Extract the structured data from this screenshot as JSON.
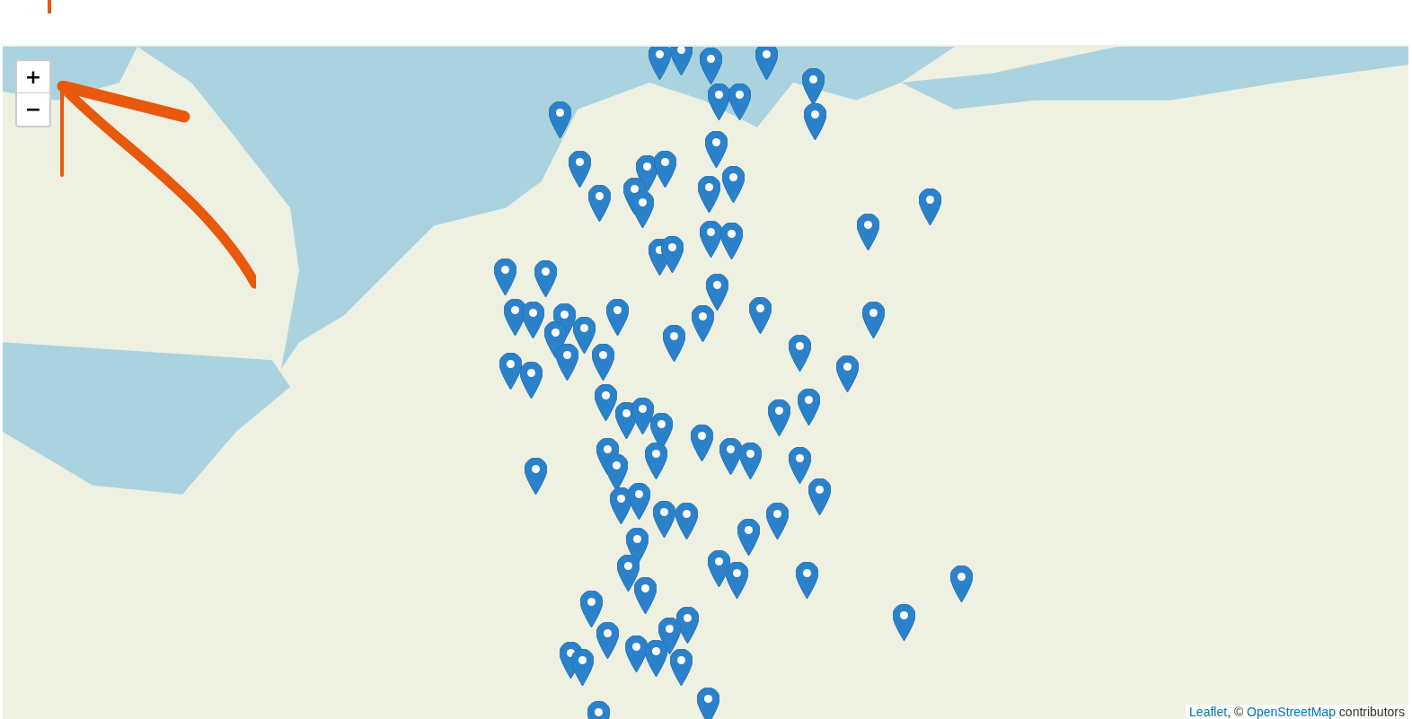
{
  "map": {
    "zoom_controls": [
      {
        "kind": "zoom-in",
        "label": "+"
      },
      {
        "kind": "zoom-out",
        "label": "−"
      }
    ],
    "attribution": {
      "links": [
        "Leaflet",
        "OpenStreetMap"
      ],
      "separator": ", © ",
      "suffix": " contributors"
    }
  }
}
